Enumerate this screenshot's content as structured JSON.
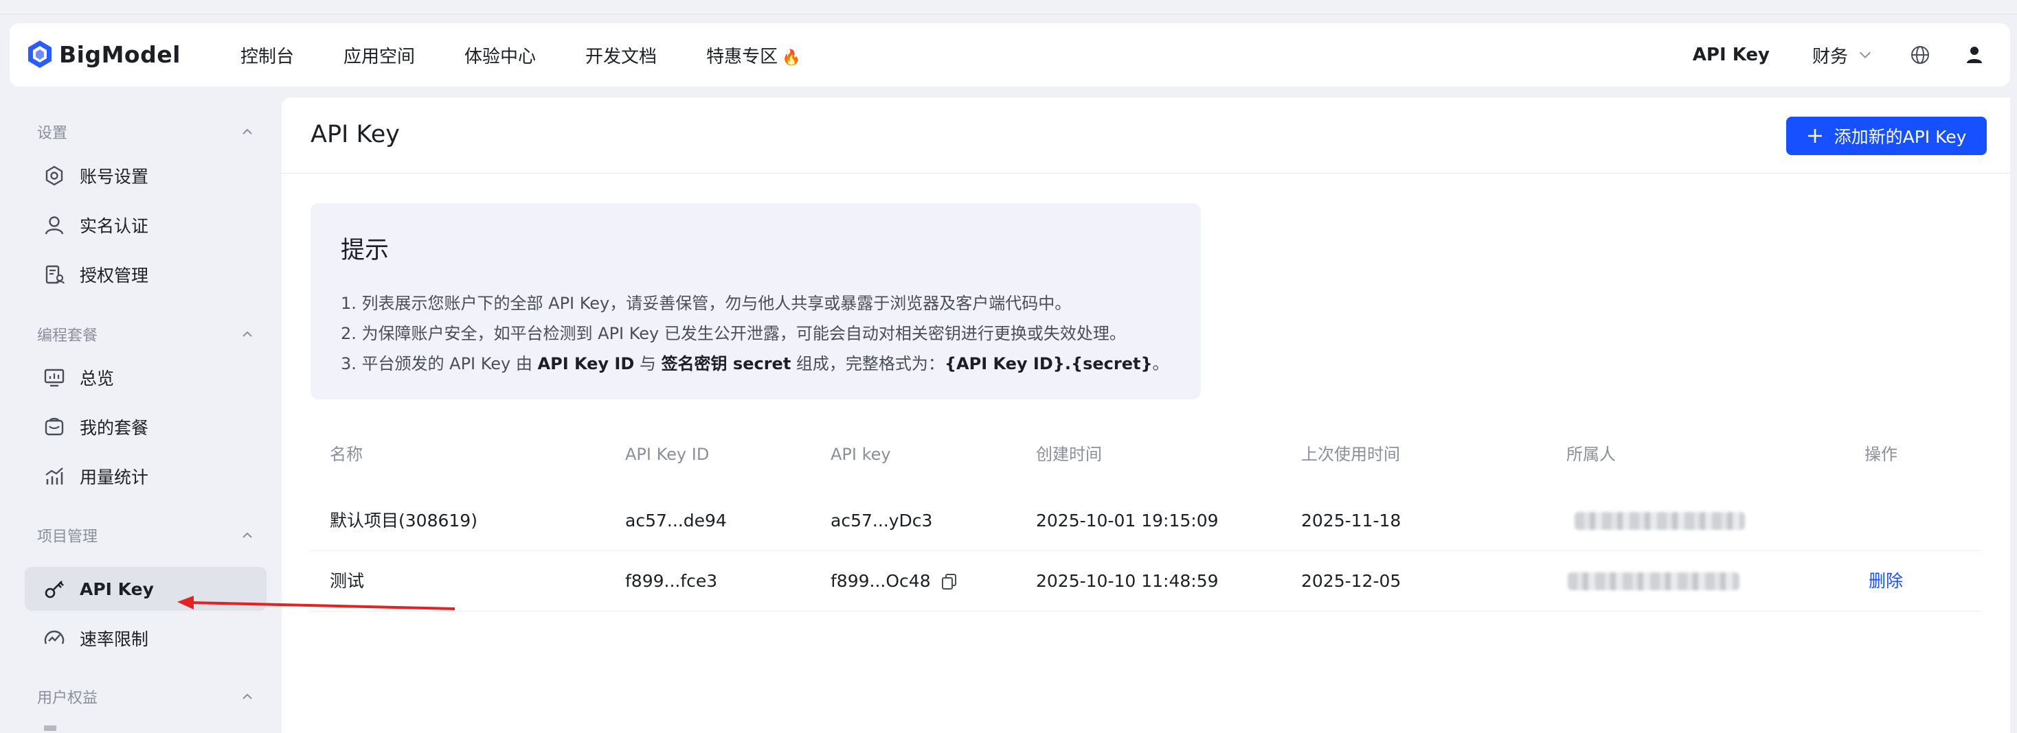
{
  "brand": {
    "name": "BigModel",
    "accent": "#1650ff",
    "logo_colors": [
      "#2b5cff",
      "#6f8dff"
    ]
  },
  "nav": {
    "items": [
      "控制台",
      "应用空间",
      "体验中心",
      "开发文档",
      "特惠专区"
    ],
    "promo_icon": "fire-icon",
    "right": {
      "api_key": "API Key",
      "finance": "财务"
    }
  },
  "sidebar": {
    "groups": [
      "设置",
      "编程套餐",
      "项目管理",
      "用户权益"
    ],
    "items": [
      {
        "label": "账号设置",
        "icon": "settings-icon"
      },
      {
        "label": "实名认证",
        "icon": "user-icon"
      },
      {
        "label": "授权管理",
        "icon": "authorization-icon"
      },
      {
        "label": "总览",
        "icon": "dashboard-icon"
      },
      {
        "label": "我的套餐",
        "icon": "package-icon"
      },
      {
        "label": "用量统计",
        "icon": "chart-icon"
      },
      {
        "label": "API Key",
        "icon": "key-icon",
        "active": true
      },
      {
        "label": "速率限制",
        "icon": "speed-icon"
      }
    ]
  },
  "page": {
    "title": "API Key",
    "add_button": "添加新的API Key"
  },
  "tips": {
    "title": "提示",
    "line1": "1. 列表展示您账户下的全部 API Key，请妥善保管，勿与他人共享或暴露于浏览器及客户端代码中。",
    "line2": "2. 为保障账户安全，如平台检测到 API Key 已发生公开泄露，可能会自动对相关密钥进行更换或失效处理。",
    "line3": {
      "prefix": "3. 平台颁发的 API Key 由 ",
      "id": "API Key ID",
      "mid1": " 与 ",
      "secret": "签名密钥 secret",
      "mid2": " 组成，完整格式为：",
      "format": "{API Key ID}.{secret}",
      "end": "。"
    }
  },
  "table": {
    "headers": [
      "名称",
      "API Key ID",
      "API key",
      "创建时间",
      "上次使用时间",
      "所属人",
      "操作"
    ],
    "rows": [
      {
        "name": "默认项目(308619)",
        "key_id": "ac57...de94",
        "api_key": "ac57...yDc3",
        "created": "2025-10-01 19:15:09",
        "last_used": "2025-11-18",
        "action": ""
      },
      {
        "name": "测试",
        "key_id": "f899...fce3",
        "api_key": "f899...Oc48",
        "created": "2025-10-10 11:48:59",
        "last_used": "2025-12-05",
        "action": "删除"
      }
    ]
  }
}
